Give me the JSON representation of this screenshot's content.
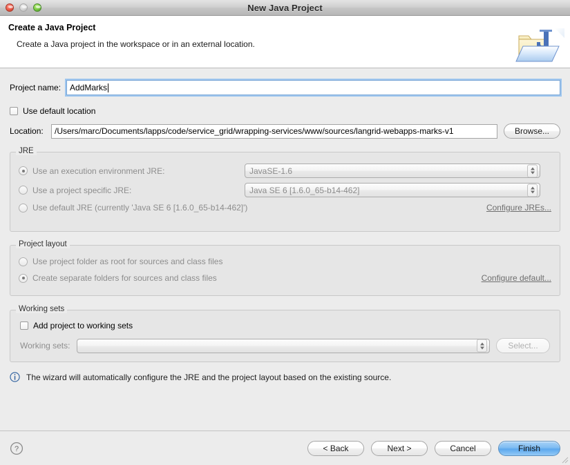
{
  "window": {
    "title": "New Java Project",
    "traffic_lights": [
      "close-button",
      "minimize-button",
      "zoom-button"
    ]
  },
  "header": {
    "title": "Create a Java Project",
    "description": "Create a Java project in the workspace or in an external location.",
    "icon": "java-project-folder-icon"
  },
  "project_name": {
    "label": "Project name:",
    "value": "AddMarks",
    "placeholder": ""
  },
  "use_default_location": {
    "label": "Use default location",
    "checked": false
  },
  "location": {
    "label": "Location:",
    "value": "/Users/marc/Documents/lapps/code/service_grid/wrapping-services/www/sources/langrid-webapps-marks-v1",
    "browse_label": "Browse..."
  },
  "jre": {
    "group_title": "JRE",
    "options": [
      {
        "label": "Use an execution environment JRE:",
        "selected": true,
        "combo_value": "JavaSE-1.6"
      },
      {
        "label": "Use a project specific JRE:",
        "selected": false,
        "combo_value": "Java SE 6 [1.6.0_65-b14-462]"
      },
      {
        "label": "Use default JRE (currently 'Java SE 6 [1.6.0_65-b14-462]')",
        "selected": false,
        "combo_value": ""
      }
    ],
    "configure_link": "Configure JREs..."
  },
  "project_layout": {
    "group_title": "Project layout",
    "options": [
      {
        "label": "Use project folder as root for sources and class files",
        "selected": false
      },
      {
        "label": "Create separate folders for sources and class files",
        "selected": true
      }
    ],
    "configure_link": "Configure default..."
  },
  "working_sets": {
    "group_title": "Working sets",
    "add_checkbox_label": "Add project to working sets",
    "add_checked": false,
    "combo_label": "Working sets:",
    "combo_value": "",
    "select_label": "Select..."
  },
  "info": {
    "icon": "info-circle-icon",
    "message": "The wizard will automatically configure the JRE and the project layout based on the existing source."
  },
  "footer": {
    "help_icon": "help-question-icon",
    "buttons": [
      {
        "label": "< Back",
        "default": false
      },
      {
        "label": "Next >",
        "default": false
      },
      {
        "label": "Cancel",
        "default": false
      },
      {
        "label": "Finish",
        "default": true
      }
    ]
  },
  "colors": {
    "accent": "#7fbcf2",
    "window_bg": "#ececec",
    "group_bg": "#e6e6e6",
    "info_blue": "#2c5f9e"
  }
}
